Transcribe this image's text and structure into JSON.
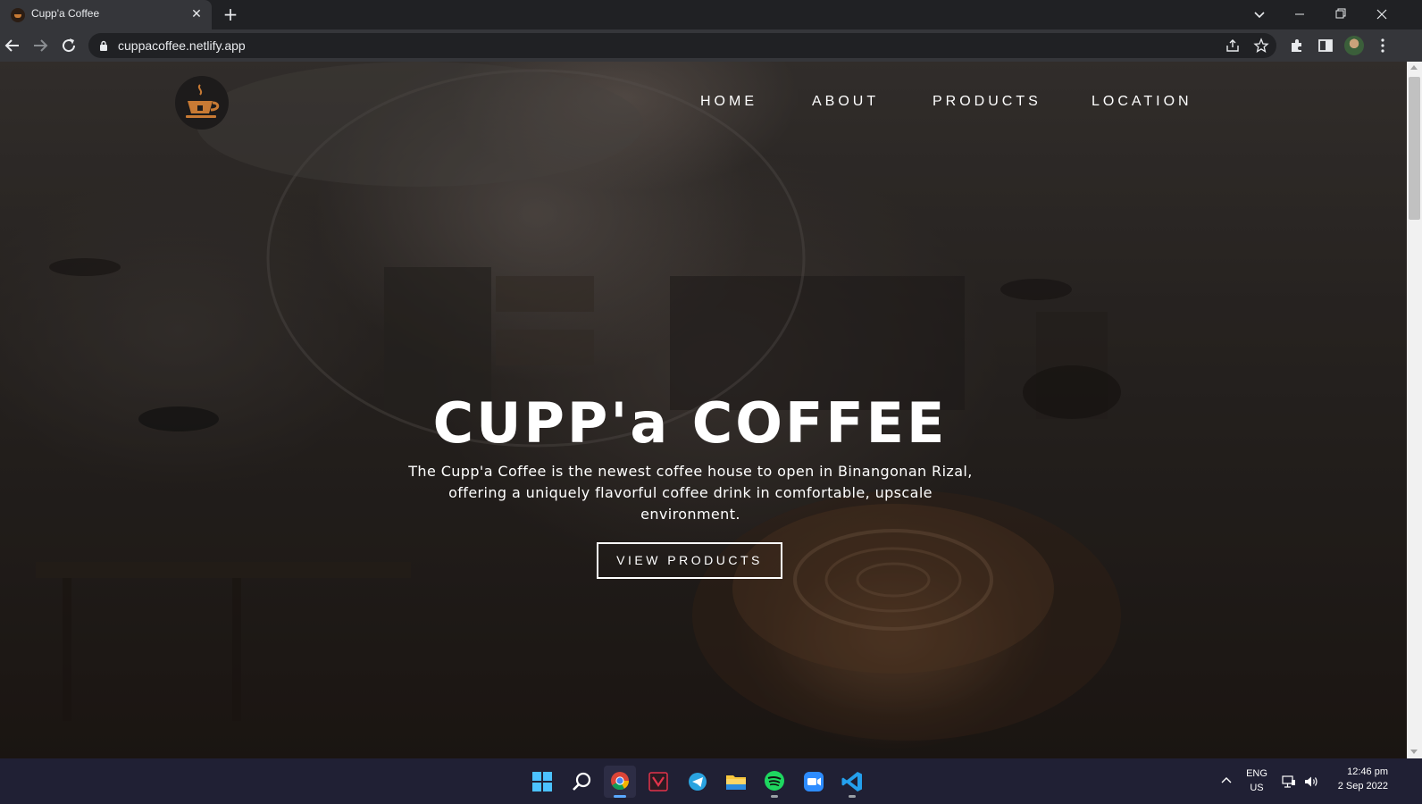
{
  "browser": {
    "tab": {
      "title": "Cupp'a Coffee",
      "close": "✕"
    },
    "new_tab": "+",
    "url": "cuppacoffee.netlify.app"
  },
  "site": {
    "nav": [
      "HOME",
      "ABOUT",
      "PRODUCTS",
      "LOCATION"
    ],
    "hero": {
      "title": "CUPP'a COFFEE",
      "description": "The Cupp'a Coffee is the newest coffee house to open in Binangonan Rizal, offering a uniquely flavorful coffee drink in comfortable, upscale environment.",
      "button": "VIEW PRODUCTS"
    }
  },
  "taskbar": {
    "apps": [
      "start-icon",
      "search-icon",
      "chrome-icon",
      "mail-icon",
      "telegram-icon",
      "file-explorer-icon",
      "spotify-icon",
      "zoom-icon",
      "vscode-icon"
    ],
    "language": {
      "line1": "ENG",
      "line2": "US"
    },
    "clock": {
      "time": "12:46 pm",
      "date": "2 Sep 2022"
    }
  },
  "colors": {
    "chrome_dark": "#202124",
    "chrome_toolbar": "#35363a",
    "accent_coffee": "#c87a34",
    "taskbar": "#202034"
  }
}
